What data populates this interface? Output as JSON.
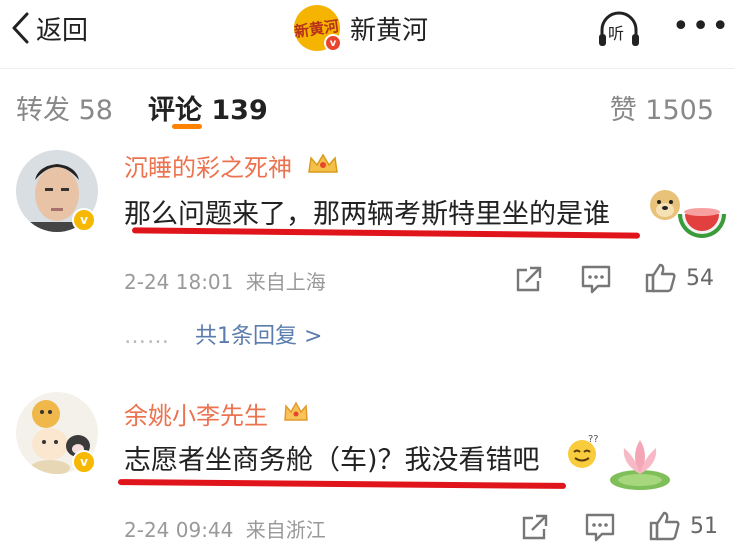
{
  "nav": {
    "back_label": "返回",
    "title": "新黄河",
    "logo_text": "新黄河",
    "listen_label": "听",
    "more_label": "•••"
  },
  "tabs": {
    "forward_label": "转发 58",
    "comment_label": "评论 139",
    "like_label": "赞 1505"
  },
  "comments": [
    {
      "username": "沉睡的彩之死神",
      "text": "那么问题来了，那两辆考斯特里坐的是谁",
      "time": "2-24 18:01",
      "location": "来自上海",
      "likes": "54",
      "replies_dots": "……",
      "replies_label": "共1条回复 >"
    },
    {
      "username": "余姚小李先生",
      "text": "志愿者坐商务舱（车)？我没看错吧",
      "time": "2-24 09:44",
      "location": "来自浙江",
      "likes": "51"
    }
  ],
  "colors": {
    "accent": "#ff8200",
    "username": "#eb7350",
    "link": "#5b7dad",
    "highlight_underline": "#e0141b",
    "verified": "#f6b800"
  }
}
